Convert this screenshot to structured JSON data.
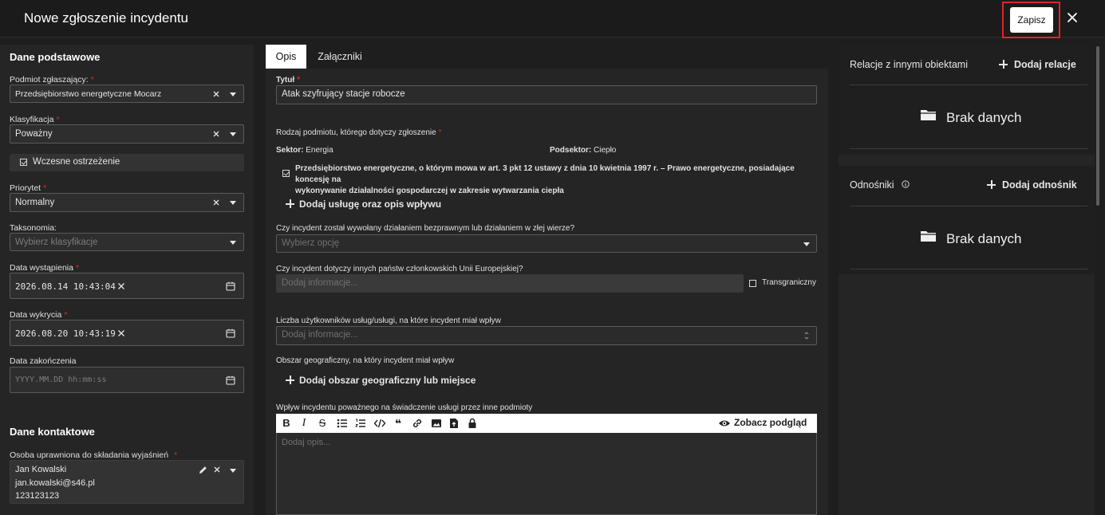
{
  "header": {
    "title": "Nowe zgłoszenie incydentu",
    "save_label": "Zapisz"
  },
  "left": {
    "basic_title": "Dane podstawowe",
    "subject_label": "Podmiot zgłaszający:",
    "subject_value": "Przedsiębiorstwo energetyczne Mocarz",
    "classification_label": "Klasyfikacja",
    "classification_value": "Poważny",
    "early_warning_label": "Wczesne ostrzeżenie",
    "priority_label": "Priorytet",
    "priority_value": "Normalny",
    "taxonomy_label": "Taksonomia:",
    "taxonomy_placeholder": "Wybierz klasyfikacje",
    "occurred_label": "Data wystąpienia",
    "occurred_value": "2026.08.14 10:43:04",
    "detected_label": "Data wykrycia",
    "detected_value": "2026.08.20 10:43:19",
    "ended_label": "Data zakończenia",
    "ended_placeholder": "YYYY.MM.DD hh:mm:ss",
    "contact_title": "Dane kontaktowe",
    "contact_person_label": "Osoba uprawniona do składania wyjaśnień",
    "contact_name": "Jan Kowalski",
    "contact_email": "jan.kowalski@s46.pl",
    "contact_phone": "123123123"
  },
  "tabs": [
    "Opis",
    "Załączniki"
  ],
  "mid": {
    "title_label": "Tytuł",
    "title_value": "Atak szyfrujący stacje robocze",
    "subject_type_label": "Rodzaj podmiotu, którego dotyczy zgłoszenie",
    "sector_label": "Sektor:",
    "sector_value": "Energia",
    "subsector_label": "Podsektor:",
    "subsector_value": "Ciepło",
    "entity_line1": "Przedsiębiorstwo energetyczne, o którym mowa w art. 3 pkt 12 ustawy z dnia 10 kwietnia 1997 r. – Prawo energetyczne, posiadające koncesję na",
    "entity_line2": "wykonywanie działalności gospodarczej w zakresie wytwarzania ciepła",
    "add_service": "Dodaj usługę oraz opis wpływu",
    "unlawful_label": "Czy incydent został wywołany działaniem bezprawnym lub działaniem w złej wierze?",
    "unlawful_placeholder": "Wybierz opcję",
    "eu_label": "Czy incydent dotyczy innych państw członkowskich Unii Europejskiej?",
    "eu_placeholder": "Dodaj informacje...",
    "crossborder_label": "Transgraniczny",
    "users_label": "Liczba użytkowników usług/usługi, na które incydent miał wpływ",
    "users_placeholder": "Dodaj informacje...",
    "geo_label": "Obszar geograficzny, na który incydent miał wpływ",
    "add_geo": "Dodaj obszar geograficzny lub miejsce",
    "impact_label": "Wpływ incydentu poważnego na świadczenie usługi przez inne podmioty",
    "preview_label": "Zobacz podgląd",
    "description_placeholder": "Dodaj opis..."
  },
  "right": {
    "relations_title": "Relacje z innymi obiektami",
    "relations_action": "Dodaj relacje",
    "relations_empty": "Brak danych",
    "references_title": "Odnośniki",
    "references_action": "Dodaj odnośnik",
    "references_empty": "Brak danych"
  },
  "colors": {
    "accent_red": "#e0242b",
    "background": "#1e1e1e",
    "panel": "#252525",
    "field": "#2e2e2e"
  }
}
